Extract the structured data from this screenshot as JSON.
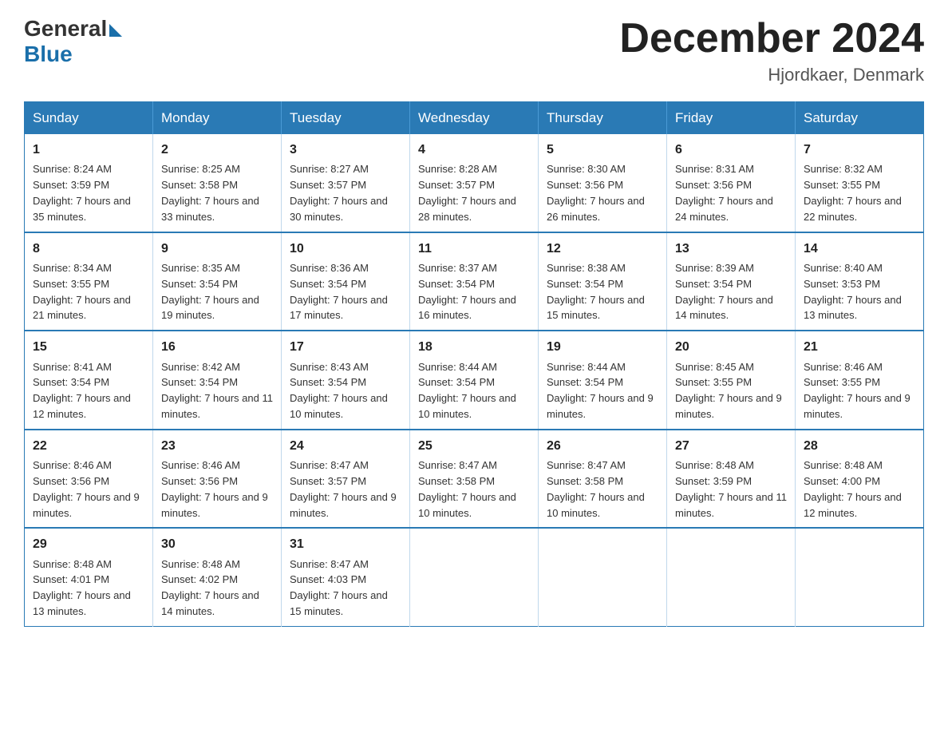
{
  "logo": {
    "general": "General",
    "blue": "Blue"
  },
  "title": "December 2024",
  "location": "Hjordkaer, Denmark",
  "days_of_week": [
    "Sunday",
    "Monday",
    "Tuesday",
    "Wednesday",
    "Thursday",
    "Friday",
    "Saturday"
  ],
  "weeks": [
    [
      {
        "day": "1",
        "sunrise": "8:24 AM",
        "sunset": "3:59 PM",
        "daylight": "7 hours and 35 minutes."
      },
      {
        "day": "2",
        "sunrise": "8:25 AM",
        "sunset": "3:58 PM",
        "daylight": "7 hours and 33 minutes."
      },
      {
        "day": "3",
        "sunrise": "8:27 AM",
        "sunset": "3:57 PM",
        "daylight": "7 hours and 30 minutes."
      },
      {
        "day": "4",
        "sunrise": "8:28 AM",
        "sunset": "3:57 PM",
        "daylight": "7 hours and 28 minutes."
      },
      {
        "day": "5",
        "sunrise": "8:30 AM",
        "sunset": "3:56 PM",
        "daylight": "7 hours and 26 minutes."
      },
      {
        "day": "6",
        "sunrise": "8:31 AM",
        "sunset": "3:56 PM",
        "daylight": "7 hours and 24 minutes."
      },
      {
        "day": "7",
        "sunrise": "8:32 AM",
        "sunset": "3:55 PM",
        "daylight": "7 hours and 22 minutes."
      }
    ],
    [
      {
        "day": "8",
        "sunrise": "8:34 AM",
        "sunset": "3:55 PM",
        "daylight": "7 hours and 21 minutes."
      },
      {
        "day": "9",
        "sunrise": "8:35 AM",
        "sunset": "3:54 PM",
        "daylight": "7 hours and 19 minutes."
      },
      {
        "day": "10",
        "sunrise": "8:36 AM",
        "sunset": "3:54 PM",
        "daylight": "7 hours and 17 minutes."
      },
      {
        "day": "11",
        "sunrise": "8:37 AM",
        "sunset": "3:54 PM",
        "daylight": "7 hours and 16 minutes."
      },
      {
        "day": "12",
        "sunrise": "8:38 AM",
        "sunset": "3:54 PM",
        "daylight": "7 hours and 15 minutes."
      },
      {
        "day": "13",
        "sunrise": "8:39 AM",
        "sunset": "3:54 PM",
        "daylight": "7 hours and 14 minutes."
      },
      {
        "day": "14",
        "sunrise": "8:40 AM",
        "sunset": "3:53 PM",
        "daylight": "7 hours and 13 minutes."
      }
    ],
    [
      {
        "day": "15",
        "sunrise": "8:41 AM",
        "sunset": "3:54 PM",
        "daylight": "7 hours and 12 minutes."
      },
      {
        "day": "16",
        "sunrise": "8:42 AM",
        "sunset": "3:54 PM",
        "daylight": "7 hours and 11 minutes."
      },
      {
        "day": "17",
        "sunrise": "8:43 AM",
        "sunset": "3:54 PM",
        "daylight": "7 hours and 10 minutes."
      },
      {
        "day": "18",
        "sunrise": "8:44 AM",
        "sunset": "3:54 PM",
        "daylight": "7 hours and 10 minutes."
      },
      {
        "day": "19",
        "sunrise": "8:44 AM",
        "sunset": "3:54 PM",
        "daylight": "7 hours and 9 minutes."
      },
      {
        "day": "20",
        "sunrise": "8:45 AM",
        "sunset": "3:55 PM",
        "daylight": "7 hours and 9 minutes."
      },
      {
        "day": "21",
        "sunrise": "8:46 AM",
        "sunset": "3:55 PM",
        "daylight": "7 hours and 9 minutes."
      }
    ],
    [
      {
        "day": "22",
        "sunrise": "8:46 AM",
        "sunset": "3:56 PM",
        "daylight": "7 hours and 9 minutes."
      },
      {
        "day": "23",
        "sunrise": "8:46 AM",
        "sunset": "3:56 PM",
        "daylight": "7 hours and 9 minutes."
      },
      {
        "day": "24",
        "sunrise": "8:47 AM",
        "sunset": "3:57 PM",
        "daylight": "7 hours and 9 minutes."
      },
      {
        "day": "25",
        "sunrise": "8:47 AM",
        "sunset": "3:58 PM",
        "daylight": "7 hours and 10 minutes."
      },
      {
        "day": "26",
        "sunrise": "8:47 AM",
        "sunset": "3:58 PM",
        "daylight": "7 hours and 10 minutes."
      },
      {
        "day": "27",
        "sunrise": "8:48 AM",
        "sunset": "3:59 PM",
        "daylight": "7 hours and 11 minutes."
      },
      {
        "day": "28",
        "sunrise": "8:48 AM",
        "sunset": "4:00 PM",
        "daylight": "7 hours and 12 minutes."
      }
    ],
    [
      {
        "day": "29",
        "sunrise": "8:48 AM",
        "sunset": "4:01 PM",
        "daylight": "7 hours and 13 minutes."
      },
      {
        "day": "30",
        "sunrise": "8:48 AM",
        "sunset": "4:02 PM",
        "daylight": "7 hours and 14 minutes."
      },
      {
        "day": "31",
        "sunrise": "8:47 AM",
        "sunset": "4:03 PM",
        "daylight": "7 hours and 15 minutes."
      },
      null,
      null,
      null,
      null
    ]
  ]
}
